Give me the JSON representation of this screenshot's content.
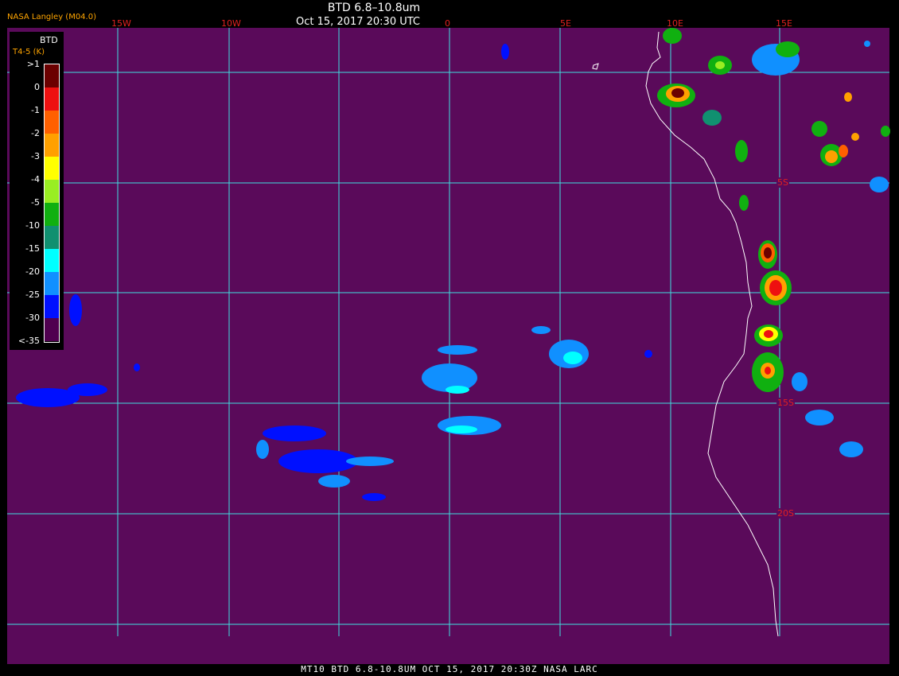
{
  "header": {
    "title": "BTD 6.8–10.8um",
    "time": "Oct 15, 2017 20:30 UTC",
    "brand": "NASA Langley (M04.0)"
  },
  "footer": {
    "text": "MT10  BTD 6.8-10.8UM  OCT 15, 2017 20:30Z  NASA LARC"
  },
  "legend": {
    "title": "BTD",
    "subtitle": "T4-5 (K)",
    "labels": [
      ">1",
      "0",
      "-1",
      "-2",
      "-3",
      "-4",
      "-5",
      "-10",
      "-15",
      "-20",
      "-25",
      "-30",
      "<-35"
    ],
    "colors": [
      "#6b0000",
      "#ee1010",
      "#ff6000",
      "#ffa000",
      "#ffff00",
      "#99ee22",
      "#10b010",
      "#109070",
      "#00ffff",
      "#1090ff",
      "#0010ff",
      "#500050"
    ]
  },
  "map": {
    "background": "#5a0a5a",
    "grid_color": "#40e0e0",
    "coast_color": "#ffffff",
    "label_color": "#e02020",
    "lon_labels": [
      "15W",
      "10W",
      "0",
      "5E",
      "10E",
      "15E"
    ],
    "lat_labels": [
      "5S",
      "15S",
      "20S"
    ]
  }
}
